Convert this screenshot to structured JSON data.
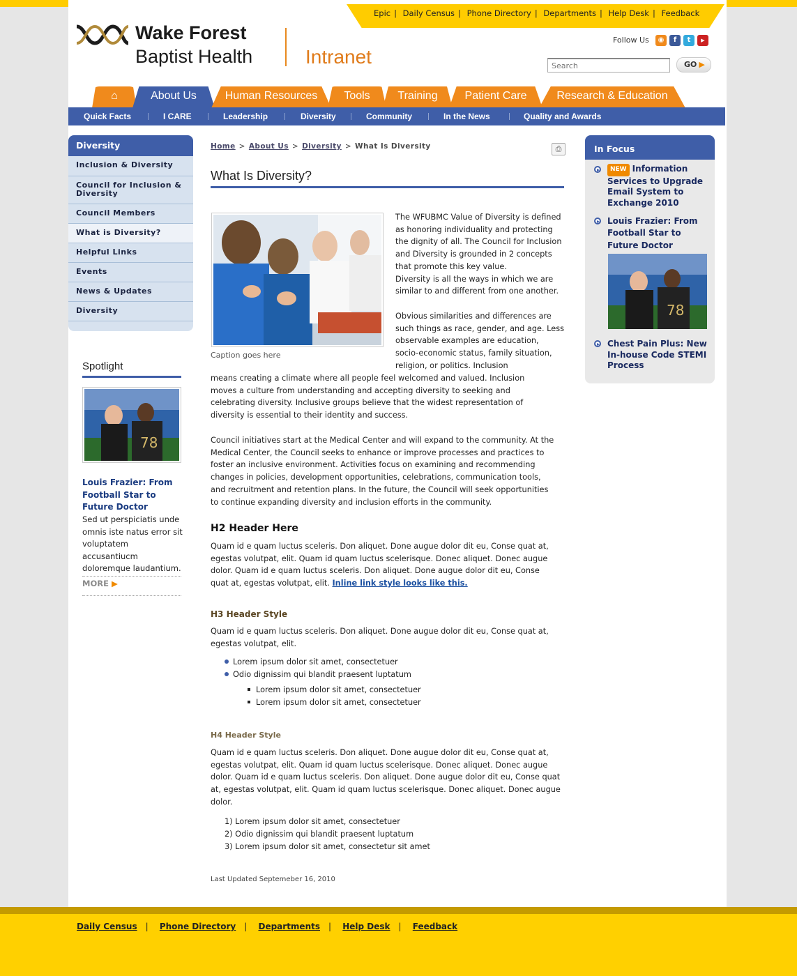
{
  "utility_links": [
    "Epic",
    "Daily Census",
    "Phone Directory",
    "Departments",
    "Help Desk",
    "Feedback"
  ],
  "logo": {
    "line1": "Wake Forest",
    "line2": "Baptist Health",
    "product": "Intranet"
  },
  "follow": {
    "label": "Follow Us"
  },
  "search": {
    "placeholder": "Search",
    "button": "GO"
  },
  "nav_tabs": [
    "About Us",
    "Human Resources",
    "Tools",
    "Training",
    "Patient Care",
    "Research & Education"
  ],
  "sub_nav": [
    "Quick Facts",
    "I CARE",
    "Leadership",
    "Diversity",
    "Community",
    "In the News",
    "Quality and Awards"
  ],
  "left_menu": {
    "title": "Diversity",
    "items": [
      "Inclusion & Diversity",
      "Council for Inclusion & Diversity",
      "Council Members",
      "What is Diversity?",
      "Helpful Links",
      "Events",
      "News & Updates",
      "Diversity"
    ]
  },
  "spotlight": {
    "title": "Spotlight",
    "link": "Louis Frazier: From Football Star to Future Doctor",
    "description": "Sed ut perspiciatis unde omnis iste natus error sit voluptatem accusantiucm doloremque laudantium.",
    "more": "MORE"
  },
  "breadcrumb": {
    "home": "Home",
    "about": "About Us",
    "diversity": "Diversity",
    "current": "What Is Diversity"
  },
  "page": {
    "title": "What Is Diversity?",
    "caption": "Caption goes here",
    "intro_lines": [
      "The WFUBMC Value of Diversity is defined",
      "as honoring individuality and protecting",
      "the dignity of all. The Council for Inclusion",
      "and Diversity is grounded in 2 concepts",
      "that promote this key value.",
      "Diversity is all the ways in which we are",
      "similar to and different from one another."
    ],
    "para2_right": [
      "Obvious similarities and differences are",
      "such things as race, gender, and age. Less",
      "observable examples are education,",
      "socio-economic status, family situation,",
      "religion, or politics. Inclusion"
    ],
    "para2_full": [
      "means creating a climate where all people feel welcomed and valued. Inclusion",
      "moves a culture from understanding and accepting diversity to seeking and",
      "celebrating diversity. Inclusive groups believe that the widest representation of",
      "diversity is essential to their identity and success."
    ],
    "para3": [
      "Council initiatives start at the Medical Center and will expand to the community. At the",
      "Medical Center, the Council seeks to enhance or improve processes and practices to",
      "foster an inclusive environment. Activities focus on examining and recommending",
      "changes in policies, development opportunities, celebrations, communication tools,",
      "and recruitment and retention plans.  In the future, the Council will seek opportunities",
      "to continue expanding diversity and inclusion efforts in the community."
    ],
    "h2": "H2 Header Here",
    "h2_para": [
      "Quam id e quam luctus sceleris. Don aliquet. Done augue dolor dit eu, Conse quat at,",
      "egestas volutpat, elit. Quam id quam luctus scelerisque. Donec aliquet. Donec augue",
      "dolor. Quam id e quam luctus sceleris. Don aliquet. Done augue dolor dit eu, Conse",
      "quat at, egestas volutpat, elit. "
    ],
    "inline_link": "Inline link style looks like this.",
    "h3": "H3 Header Style",
    "h3_para": [
      "Quam id e quam luctus sceleris. Don aliquet. Done augue dolor dit eu, Conse quat at,",
      "egestas volutpat, elit."
    ],
    "bullets": [
      "Lorem ipsum dolor sit amet, consectetuer",
      "Odio dignissim qui blandit praesent luptatum"
    ],
    "sub_bullets": [
      "Lorem ipsum dolor sit amet, consectetuer",
      "Lorem ipsum dolor sit amet, consectetuer"
    ],
    "h4": "H4 Header Style",
    "h4_para": [
      "Quam id e quam luctus sceleris. Don aliquet. Done augue dolor dit eu, Conse quat at,",
      "egestas volutpat, elit. Quam id quam luctus scelerisque. Donec aliquet. Donec augue",
      "dolor. Quam id e quam luctus sceleris. Don aliquet. Done augue dolor dit eu, Conse quat",
      "at, egestas volutpat, elit. Quam id quam luctus scelerisque. Donec aliquet. Donec augue",
      "dolor."
    ],
    "numbered": [
      "1) Lorem ipsum dolor sit amet, consectetuer",
      "2) Odio dignissim qui blandit praesent luptatum",
      "3) Lorem ipsum dolor sit amet, consectetur sit amet"
    ],
    "updated": "Last Updated Septemeber 16, 2010"
  },
  "in_focus": {
    "title": "In Focus",
    "badge": "NEW",
    "item1": [
      "Information",
      "Services to Upgrade",
      "Email System to",
      "Exchange 2010"
    ],
    "item2": [
      "Louis Frazier: From",
      "Football Star to",
      "Future Doctor"
    ],
    "item3": [
      "Chest Pain Plus: New",
      "In-house Code STEMI",
      "Process"
    ]
  },
  "footer_links": [
    "Daily Census",
    "Phone Directory",
    "Departments",
    "Help Desk",
    "Feedback"
  ],
  "colors": {
    "brand_blue": "#3f5ea8",
    "brand_orange": "#f08a1c",
    "brand_yellow": "#ffcc00"
  }
}
